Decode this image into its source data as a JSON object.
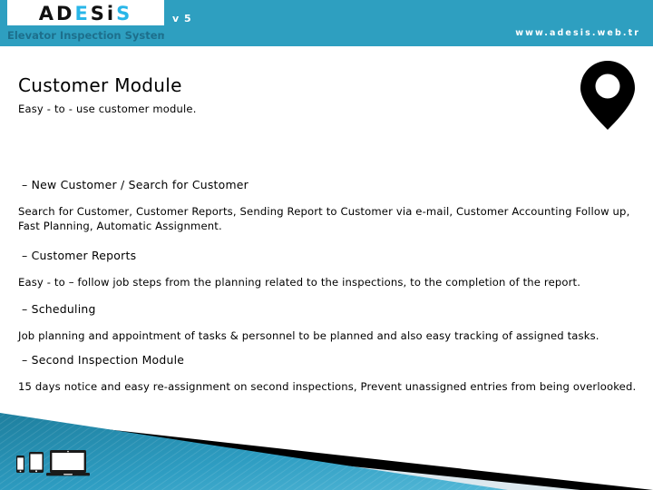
{
  "header": {
    "logo": {
      "word_parts": [
        {
          "text": "A",
          "accent": false
        },
        {
          "text": "D",
          "accent": false
        },
        {
          "text": "E",
          "accent": true
        },
        {
          "text": "S",
          "accent": false
        },
        {
          "text": "i",
          "accent": false
        },
        {
          "text": "S",
          "accent": true
        }
      ],
      "word_plain": "ADESiS",
      "subtitle": "Elevator Inspection System"
    },
    "version": "v 5",
    "website": "www.adesis.web.tr",
    "band_color": "#2e9fc0",
    "accent_color": "#29b6e8",
    "subtitle_color": "#1d6f8c"
  },
  "decorations": {
    "map_pin_icon": "location-pin-icon",
    "devices": [
      "smartphone-icon",
      "tablet-icon",
      "laptop-icon"
    ],
    "band_teal": "#2b92b5",
    "band_black": "#000000",
    "band_light": "#dce8ee"
  },
  "main": {
    "title": "Customer Module",
    "subtitle": "Easy - to - use customer module.",
    "sections": [
      {
        "heading": "– New Customer / Search for Customer",
        "paragraph": "Search for Customer, Customer Reports, Sending Report to Customer via e-mail, Customer Accounting Follow up, Fast Planning, Automatic Assignment."
      },
      {
        "heading": "– Customer Reports",
        "paragraph": "Easy - to – follow job steps from the planning related to the inspections, to the completion of the report."
      },
      {
        "heading": "–  Scheduling",
        "paragraph": "Job planning and appointment of tasks & personnel to be planned and also easy tracking of assigned tasks."
      },
      {
        "heading": "– Second Inspection Module",
        "paragraph": "15 days notice and easy re-assignment on second inspections, Prevent unassigned entries from being overlooked."
      }
    ]
  }
}
